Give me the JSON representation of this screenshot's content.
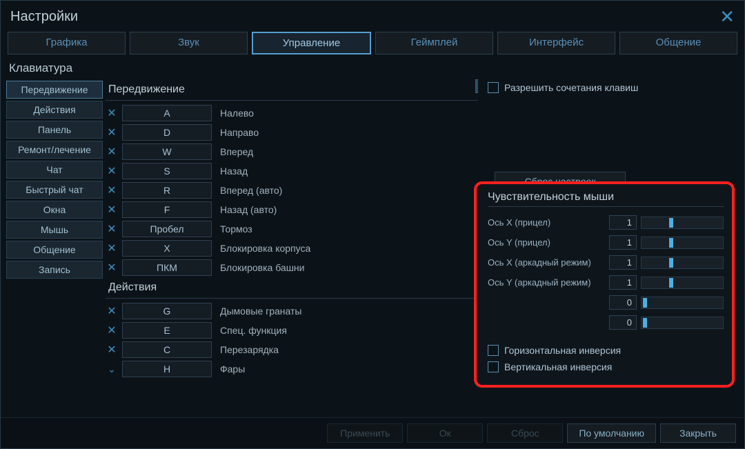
{
  "title": "Настройки",
  "top_tabs": [
    "Графика",
    "Звук",
    "Управление",
    "Геймплей",
    "Интерфейс",
    "Общение"
  ],
  "active_top_tab": 2,
  "section_label": "Клавиатура",
  "sidebar": {
    "items": [
      "Передвижение",
      "Действия",
      "Панель",
      "Ремонт/лечение",
      "Чат",
      "Быстрый чат",
      "Окна",
      "Мышь",
      "Общение",
      "Запись"
    ],
    "active": 0
  },
  "groups": [
    {
      "title": "Передвижение",
      "binds": [
        {
          "key": "A",
          "label": "Налево",
          "icon": "x"
        },
        {
          "key": "D",
          "label": "Направо",
          "icon": "x"
        },
        {
          "key": "W",
          "label": "Вперед",
          "icon": "x"
        },
        {
          "key": "S",
          "label": "Назад",
          "icon": "x"
        },
        {
          "key": "R",
          "label": "Вперед (авто)",
          "icon": "x"
        },
        {
          "key": "F",
          "label": "Назад (авто)",
          "icon": "x"
        },
        {
          "key": "Пробел",
          "label": "Тормоз",
          "icon": "x"
        },
        {
          "key": "X",
          "label": "Блокировка корпуса",
          "icon": "x"
        },
        {
          "key": "ПКМ",
          "label": "Блокировка башни",
          "icon": "x"
        }
      ]
    },
    {
      "title": "Действия",
      "binds": [
        {
          "key": "G",
          "label": "Дымовые гранаты",
          "icon": "x"
        },
        {
          "key": "E",
          "label": "Спец. функция",
          "icon": "x"
        },
        {
          "key": "C",
          "label": "Перезарядка",
          "icon": "x"
        },
        {
          "key": "Н",
          "label": "Фары",
          "icon": "down"
        }
      ]
    }
  ],
  "right": {
    "allow_combinations": "Разрешить сочетания клавиш",
    "reset_label": "Сброс настроек",
    "sensitivity": {
      "title": "Чувствительность мыши",
      "rows": [
        {
          "label": "Ось X (прицел)",
          "value": "1",
          "thumb": 40
        },
        {
          "label": "Ось Y (прицел)",
          "value": "1",
          "thumb": 40
        },
        {
          "label": "Ось X (аркадный режим)",
          "value": "1",
          "thumb": 40
        },
        {
          "label": "Ось Y (аркадный режим)",
          "value": "1",
          "thumb": 40
        },
        {
          "label": "",
          "value": "0",
          "thumb": 2
        },
        {
          "label": "",
          "value": "0",
          "thumb": 2
        }
      ],
      "invert_h": "Горизонтальная инверсия",
      "invert_v": "Вертикальная инверсия"
    }
  },
  "bottom": {
    "apply": "Применить",
    "ok": "Ок",
    "reset": "Сброс",
    "default": "По умолчанию",
    "close": "Закрыть"
  }
}
